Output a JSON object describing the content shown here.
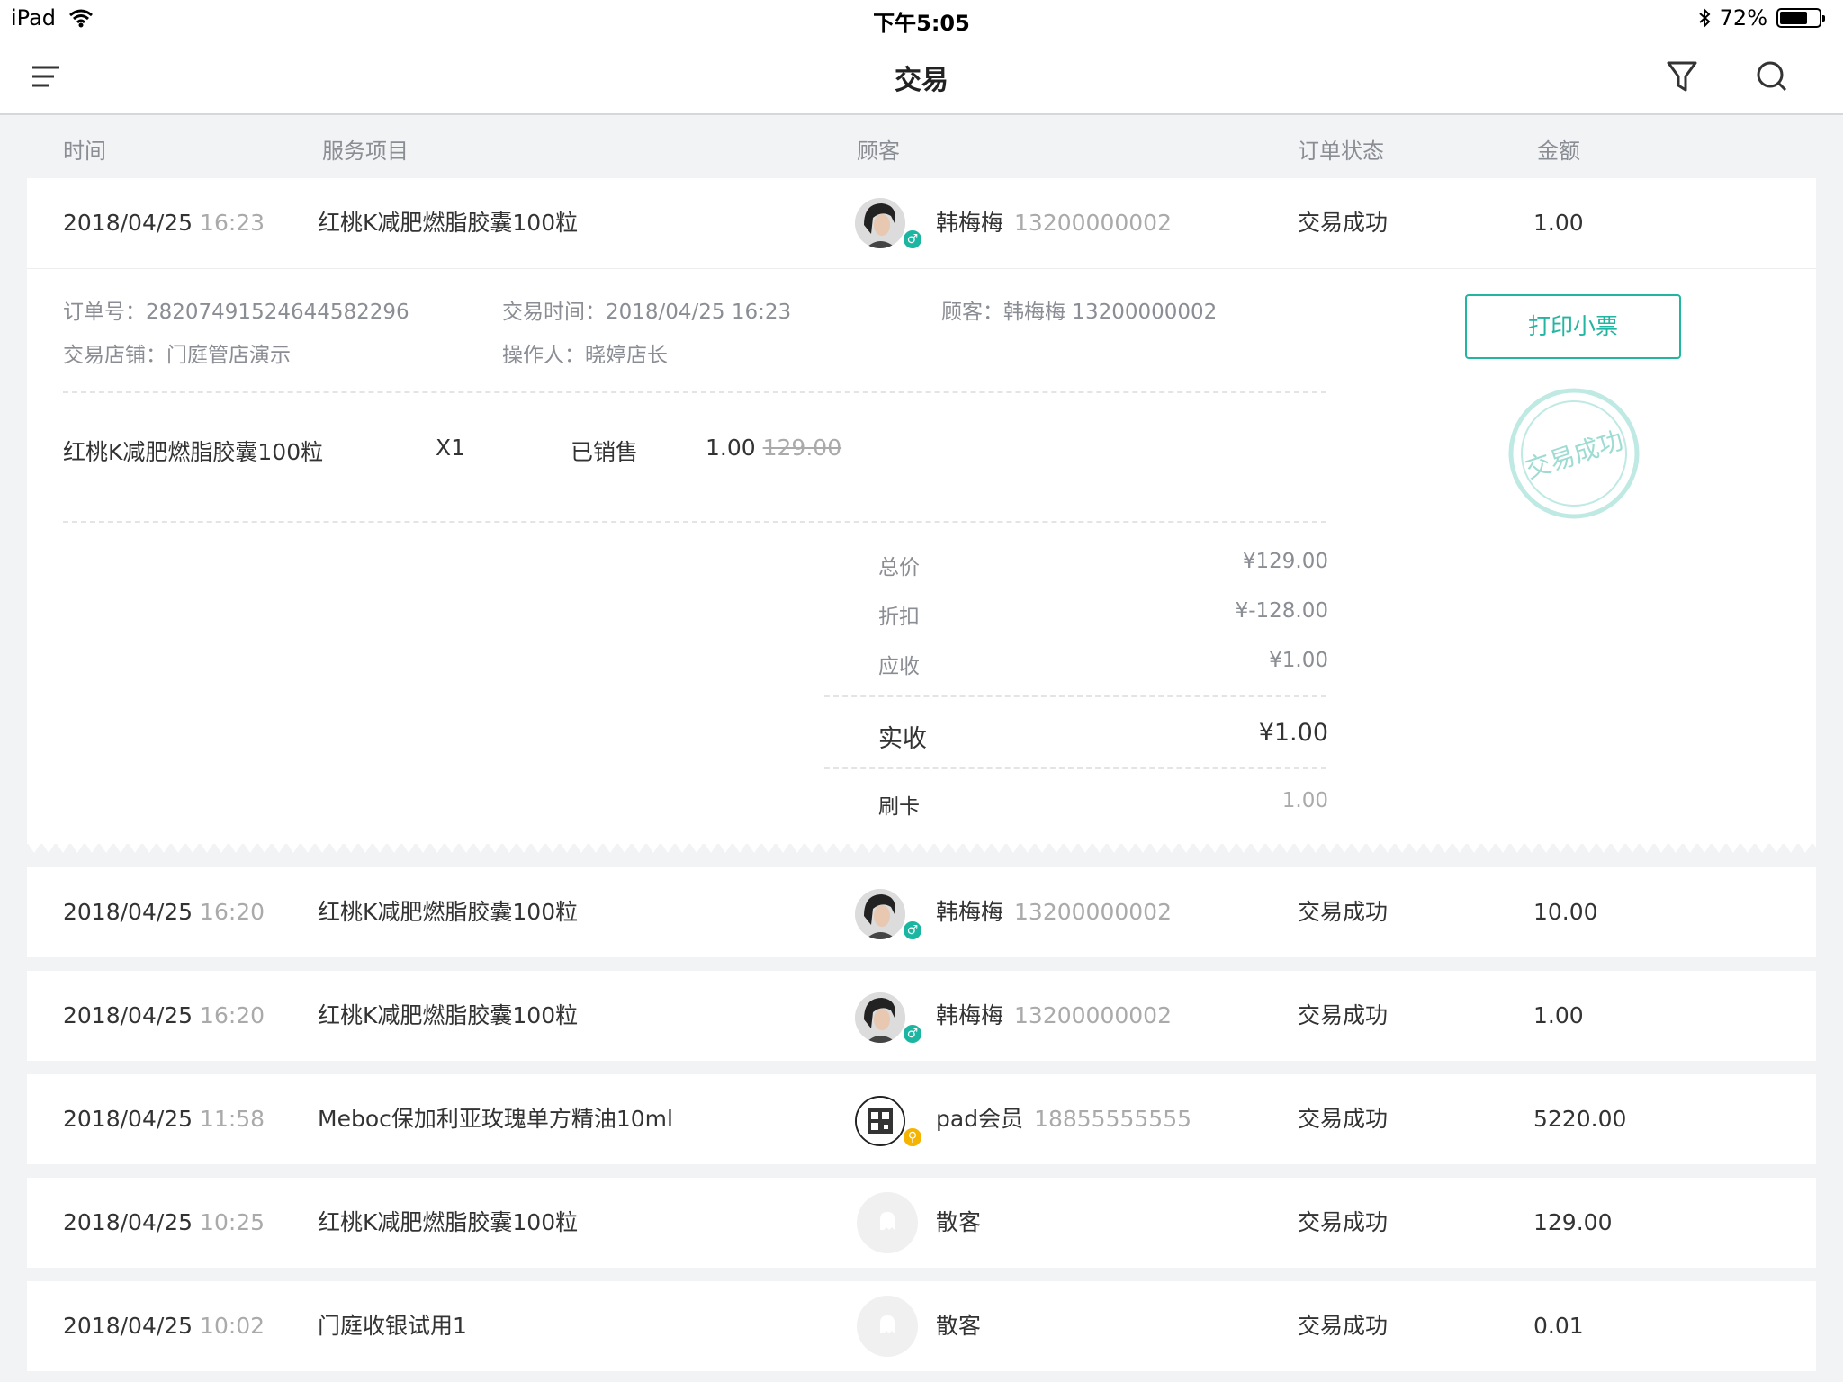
{
  "status_bar": {
    "device": "iPad",
    "time": "下午5:05",
    "battery_text": "72%",
    "battery_level": 0.72
  },
  "header": {
    "title": "交易"
  },
  "columns": {
    "time": "时间",
    "service": "服务项目",
    "customer": "顾客",
    "status": "订单状态",
    "amount": "金额"
  },
  "expanded": {
    "row": {
      "date": "2018/04/25",
      "time": "16:23",
      "item": "红桃K减肥燃脂胶囊100粒",
      "name": "韩梅梅",
      "phone": "13200000002",
      "status": "交易成功",
      "amount": "1.00"
    },
    "order_no_label": "订单号：",
    "order_no": "2820749152464458229​6",
    "trade_time_label": "交易时间：",
    "trade_time": "2018/04/25 16:23",
    "customer_label": "顾客：",
    "customer": "韩梅梅 13200000002",
    "store_label": "交易店铺：",
    "store": "门庭管店演示",
    "operator_label": "操作人：",
    "operator": "晓婷店长",
    "print_button": "打印小票",
    "stamp_text": "交易成功",
    "line_item": {
      "name": "红桃K减肥燃脂胶囊100粒",
      "qty": "X1",
      "state": "已销售",
      "price": "1.00",
      "original_price": "129.00"
    },
    "summary": {
      "total_label": "总价",
      "total": "¥129.00",
      "discount_label": "折扣",
      "discount": "¥-128.00",
      "receivable_label": "应收",
      "receivable": "¥1.00",
      "received_label": "实收",
      "received": "¥1.00",
      "card_label": "刷卡",
      "card": "1.00"
    }
  },
  "rows": [
    {
      "date": "2018/04/25",
      "time": "16:20",
      "item": "红桃K减肥燃脂胶囊100粒",
      "name": "韩梅梅",
      "phone": "13200000002",
      "status": "交易成功",
      "amount": "10.00"
    },
    {
      "date": "2018/04/25",
      "time": "16:20",
      "item": "红桃K减肥燃脂胶囊100粒",
      "name": "韩梅梅",
      "phone": "13200000002",
      "status": "交易成功",
      "amount": "1.00"
    },
    {
      "date": "2018/04/25",
      "time": "11:58",
      "item": "Meboc保加利亚玫瑰单方精油10ml",
      "name": "pad会员",
      "phone": "18855555555",
      "status": "交易成功",
      "amount": "5220.00"
    },
    {
      "date": "2018/04/25",
      "time": "10:25",
      "item": "红桃K减肥燃脂胶囊100粒",
      "name": "散客",
      "phone": "",
      "status": "交易成功",
      "amount": "129.00"
    },
    {
      "date": "2018/04/25",
      "time": "10:02",
      "item": "门庭收银试用1",
      "name": "散客",
      "phone": "",
      "status": "交易成功",
      "amount": "0.01"
    }
  ],
  "colors": {
    "accent": "#21b5a2",
    "muted": "#8a8d93",
    "background": "#f2f3f5"
  }
}
